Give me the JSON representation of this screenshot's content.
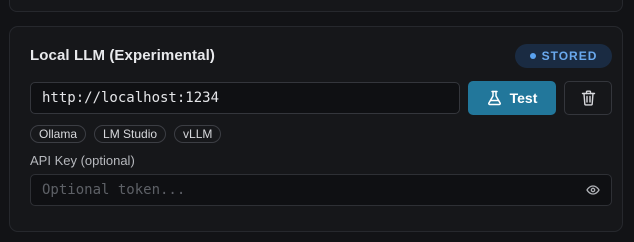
{
  "card": {
    "title": "Local LLM (Experimental)",
    "status": "STORED"
  },
  "endpoint": {
    "value": "http://localhost:1234"
  },
  "actions": {
    "test_label": "Test",
    "test_icon": "flask-icon",
    "delete_icon": "trash-icon"
  },
  "presets": [
    "Ollama",
    "LM Studio",
    "vLLM"
  ],
  "api_key": {
    "label": "API Key (optional)",
    "placeholder": "Optional token...",
    "value": "",
    "icon": "eye-icon"
  },
  "colors": {
    "accent": "#22779b",
    "status_badge_bg": "#1a2b42",
    "status_text": "#6aa9ee"
  }
}
